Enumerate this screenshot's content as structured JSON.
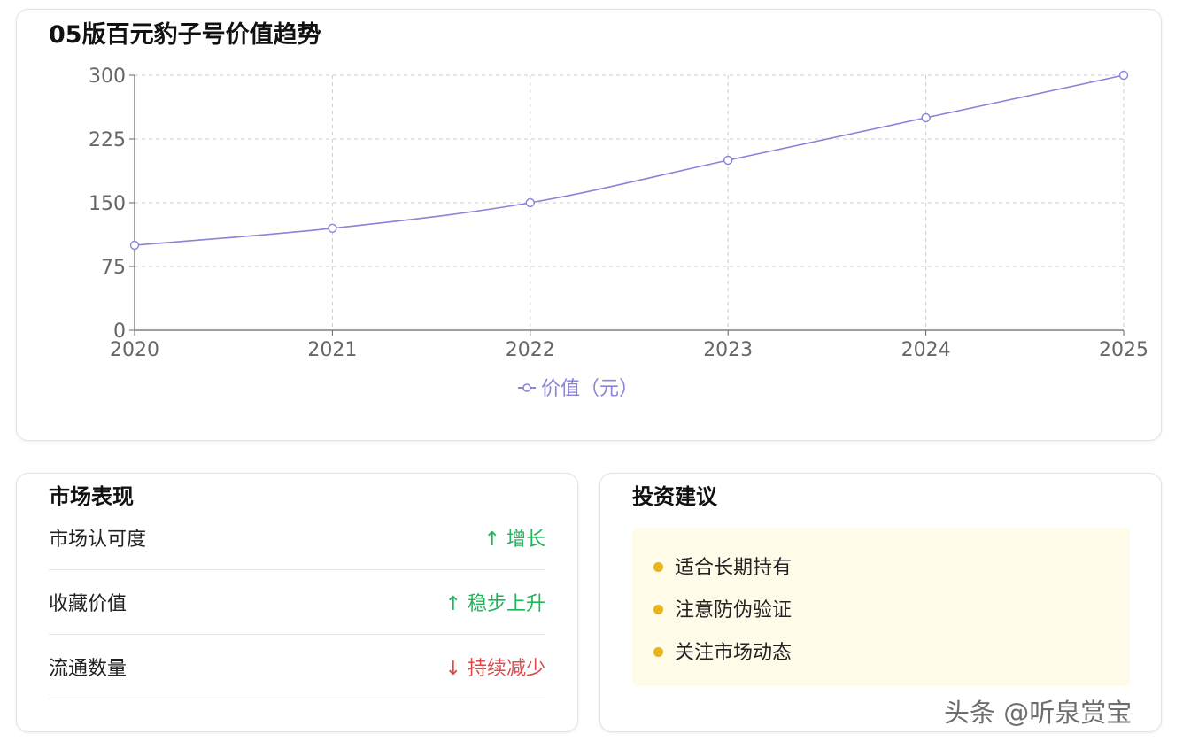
{
  "chart_card": {
    "title": "05版百元豹子号价值趋势"
  },
  "chart_data": {
    "type": "line",
    "title": "05版百元豹子号价值趋势",
    "x": [
      "2020",
      "2021",
      "2022",
      "2023",
      "2024",
      "2025"
    ],
    "series": [
      {
        "name": "价值（元）",
        "values": [
          100,
          120,
          150,
          200,
          250,
          300
        ],
        "color": "#8884d8"
      }
    ],
    "ylim": [
      0,
      300
    ],
    "yticks": [
      0,
      75,
      150,
      225,
      300
    ],
    "grid": true,
    "legend": "bottom-center"
  },
  "market": {
    "title": "市场表现",
    "rows": [
      {
        "label": "市场认可度",
        "value": "↑ 增长",
        "trend": "up"
      },
      {
        "label": "收藏价值",
        "value": "↑ 稳步上升",
        "trend": "up"
      },
      {
        "label": "流通数量",
        "value": "↓ 持续减少",
        "trend": "down"
      }
    ]
  },
  "advice": {
    "title": "投资建议",
    "items": [
      "适合长期持有",
      "注意防伪验证",
      "关注市场动态"
    ]
  },
  "watermark": "头条 @听泉赏宝",
  "colors": {
    "line": "#8884d8",
    "up": "#22b45a",
    "down": "#e2484a",
    "bullet": "#e6b41d",
    "advice_bg": "#fefbe8"
  }
}
